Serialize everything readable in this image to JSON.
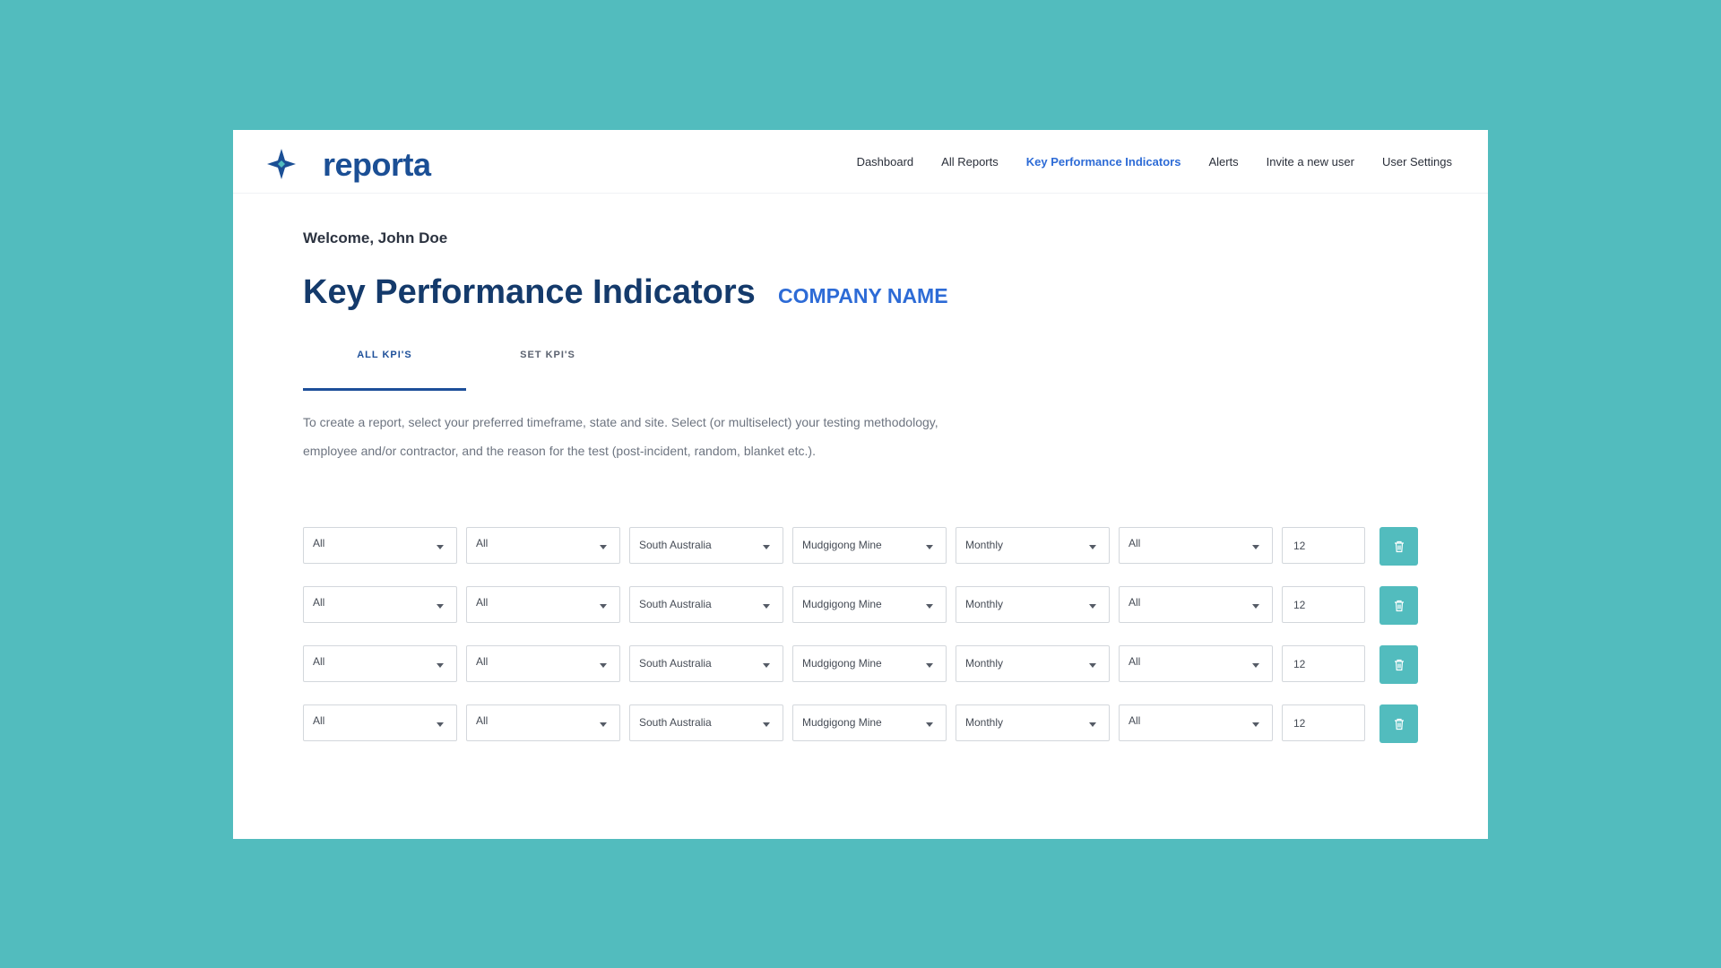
{
  "app": {
    "name": "reporta"
  },
  "nav": {
    "items": [
      {
        "label": "Dashboard",
        "active": false
      },
      {
        "label": "All Reports",
        "active": false
      },
      {
        "label": "Key Performance Indicators",
        "active": true
      },
      {
        "label": "Alerts",
        "active": false
      },
      {
        "label": "Invite a new user",
        "active": false
      },
      {
        "label": "User Settings",
        "active": false
      }
    ]
  },
  "main": {
    "welcome": "Welcome, John Doe",
    "title": "Key Performance Indicators",
    "company": "COMPANY NAME",
    "tabs": [
      {
        "label": "ALL KPI'S",
        "active": true
      },
      {
        "label": "SET KPI'S",
        "active": false
      }
    ],
    "description_line1": "To create a report, select your preferred timeframe, state and site. Select (or multiselect) your testing methodology,",
    "description_line2": "employee and/or contractor, and the reason for the test (post-incident, random, blanket etc.)."
  },
  "kpi_rows": [
    {
      "f1": "All",
      "f2": "All",
      "state": "South Australia",
      "site": "Mudgigong Mine",
      "period": "Monthly",
      "f6": "All",
      "target": "12"
    },
    {
      "f1": "All",
      "f2": "All",
      "state": "South Australia",
      "site": "Mudgigong Mine",
      "period": "Monthly",
      "f6": "All",
      "target": "12"
    },
    {
      "f1": "All",
      "f2": "All",
      "state": "South Australia",
      "site": "Mudgigong Mine",
      "period": "Monthly",
      "f6": "All",
      "target": "12"
    },
    {
      "f1": "All",
      "f2": "All",
      "state": "South Australia",
      "site": "Mudgigong Mine",
      "period": "Monthly",
      "f6": "All",
      "target": "12"
    }
  ],
  "icons": {
    "logo": "star-logo-icon",
    "caret": "caret-down-icon",
    "delete": "trash-icon"
  },
  "colors": {
    "background": "#52bcbe",
    "brand": "#1b4f95",
    "title": "#143a6b",
    "accent": "#2d6bd6",
    "button": "#52bcbe"
  }
}
